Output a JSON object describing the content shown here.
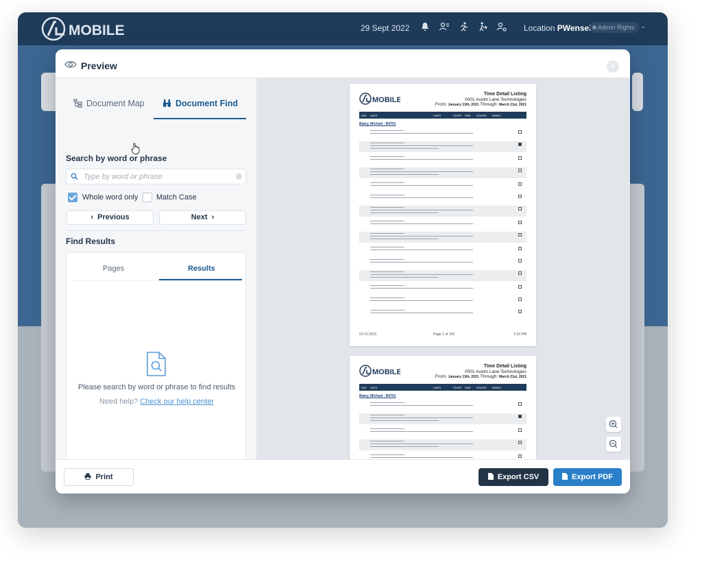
{
  "app": {
    "logo_text": "MOBILE",
    "date": "29 Sept 2022",
    "location_label": "Location",
    "location_user": "PWensel",
    "role_badge": "Admin Rights"
  },
  "modal": {
    "title": "Preview",
    "tabs": [
      {
        "label": "Document Map",
        "active": false
      },
      {
        "label": "Document Find",
        "active": true
      }
    ],
    "search": {
      "title": "Search by word or phrase",
      "placeholder": "Type by word or phrase",
      "value": "",
      "whole_word_label": "Whole word only",
      "whole_word_checked": true,
      "match_case_label": "Match Case",
      "match_case_checked": false,
      "prev_label": "Previous",
      "next_label": "Next"
    },
    "results": {
      "title": "Find Results",
      "tabs": [
        {
          "label": "Pages",
          "active": false
        },
        {
          "label": "Results",
          "active": true
        }
      ],
      "empty_message": "Please search by word or phrase to find results",
      "help_prefix": "Need help?",
      "help_link": "Check our help center"
    },
    "footer": {
      "print_label": "Print",
      "export_csv_label": "Export CSV",
      "export_pdf_label": "Export PDF"
    }
  },
  "document": {
    "title": "Time Detail Listing",
    "company": "0001 Austin Lane Technologies",
    "from_label": "From:",
    "from_date": "January 13th, 2021",
    "through_label": "Through:",
    "through_date": "March 21st, 2021",
    "columns": [
      "DAY",
      "DATE",
      "USER",
      "START",
      "END",
      "HOURS",
      "MEMO"
    ],
    "employee": "Batey, Michael - B4701",
    "footer_date": "03.01.2023",
    "footer_page": "Page 1 of 100",
    "footer_time": "5:20 PM"
  },
  "colors": {
    "brand_navy": "#1f3b5a",
    "accent_blue": "#2a7fc9",
    "link_blue": "#4a90d0",
    "checkbox_blue": "#6aa7dc"
  }
}
